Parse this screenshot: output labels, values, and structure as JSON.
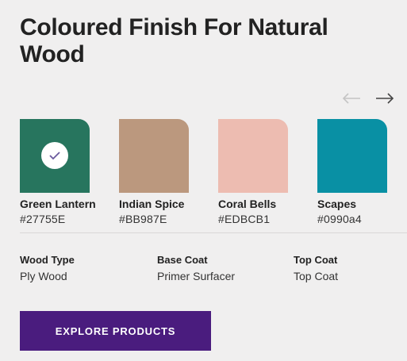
{
  "page": {
    "title": "Coloured Finish For Natural Wood"
  },
  "navigation": {
    "prev_icon": "arrow-left-icon",
    "next_icon": "arrow-right-icon"
  },
  "swatches": [
    {
      "name": "Green Lantern",
      "hex_label": "#27755E",
      "color": "#27755E",
      "selected": true
    },
    {
      "name": "Indian Spice",
      "hex_label": "#BB987E",
      "color": "#BB987E",
      "selected": false
    },
    {
      "name": "Coral Bells",
      "hex_label": "#EDBCB1",
      "color": "#EDBCB1",
      "selected": false
    },
    {
      "name": "Scapes",
      "hex_label": "#0990a4",
      "color": "#0990a4",
      "selected": false
    }
  ],
  "specs": {
    "wood_type": {
      "label": "Wood Type",
      "value": "Ply Wood"
    },
    "base_coat": {
      "label": "Base Coat",
      "value": "Primer Surfacer"
    },
    "top_coat": {
      "label": "Top Coat",
      "value": "Top Coat"
    }
  },
  "cta": {
    "label": "EXPLORE PRODUCTS",
    "color": "#4a1c7e"
  },
  "colors": {
    "background": "#f0efef",
    "check_mark": "#6b5a9e"
  }
}
